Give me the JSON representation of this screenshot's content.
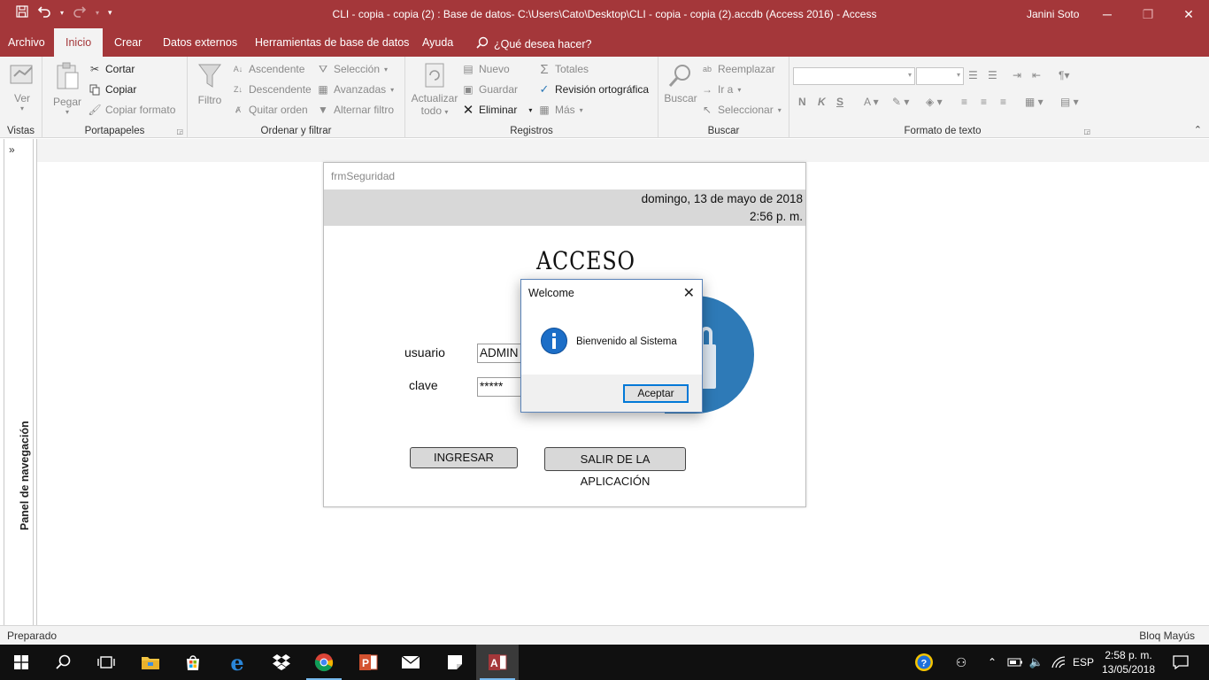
{
  "titlebar": {
    "title": "CLI - copia - copia (2) : Base de datos- C:\\Users\\Cato\\Desktop\\CLI - copia - copia (2).accdb (Access 2016)  -  Access",
    "user": "Janini Soto"
  },
  "tabs": [
    "Archivo",
    "Inicio",
    "Crear",
    "Datos externos",
    "Herramientas de base de datos",
    "Ayuda"
  ],
  "tell_me": "¿Qué desea hacer?",
  "ribbon": {
    "vistas": {
      "ver": "Ver",
      "label": "Vistas"
    },
    "portapapeles": {
      "pegar": "Pegar",
      "cortar": "Cortar",
      "copiar": "Copiar",
      "copiar_formato": "Copiar formato",
      "label": "Portapapeles"
    },
    "ordenar": {
      "filtro": "Filtro",
      "ascendente": "Ascendente",
      "descendente": "Descendente",
      "quitar_orden": "Quitar orden",
      "seleccion": "Selección",
      "avanzadas": "Avanzadas",
      "alternar_filtro": "Alternar filtro",
      "label": "Ordenar y filtrar"
    },
    "registros": {
      "actualizar": "Actualizar",
      "todo": "todo",
      "nuevo": "Nuevo",
      "guardar": "Guardar",
      "eliminar": "Eliminar",
      "totales": "Totales",
      "revision": "Revisión ortográfica",
      "mas": "Más",
      "label": "Registros"
    },
    "buscar": {
      "buscar": "Buscar",
      "reemplazar": "Reemplazar",
      "ir_a": "Ir a",
      "seleccionar": "Seleccionar",
      "label": "Buscar"
    },
    "formato": {
      "label": "Formato de texto",
      "bold": "N",
      "italic": "K",
      "underline": "S"
    }
  },
  "nav_pane": {
    "label": "Panel de navegación"
  },
  "form": {
    "title": "frmSeguridad",
    "date": "domingo, 13 de mayo de 2018",
    "time": "2:56 p. m.",
    "heading": "ACCESO",
    "usuario_label": "usuario",
    "usuario_value": "ADMIN",
    "clave_label": "clave",
    "clave_value": "*****",
    "ingresar": "INGRESAR",
    "salir": "SALIR DE LA APLICACIÓN"
  },
  "dialog": {
    "title": "Welcome",
    "message": "Bienvenido al Sistema",
    "ok": "Aceptar"
  },
  "statusbar": {
    "left": "Preparado",
    "right": "Bloq Mayús"
  },
  "taskbar": {
    "lang": "ESP",
    "time": "2:58 p. m.",
    "date": "13/05/2018"
  },
  "colors": {
    "access_accent": "#a4373a",
    "dialog_border": "#5b84b9",
    "lock_blue": "#2e7ab7"
  }
}
